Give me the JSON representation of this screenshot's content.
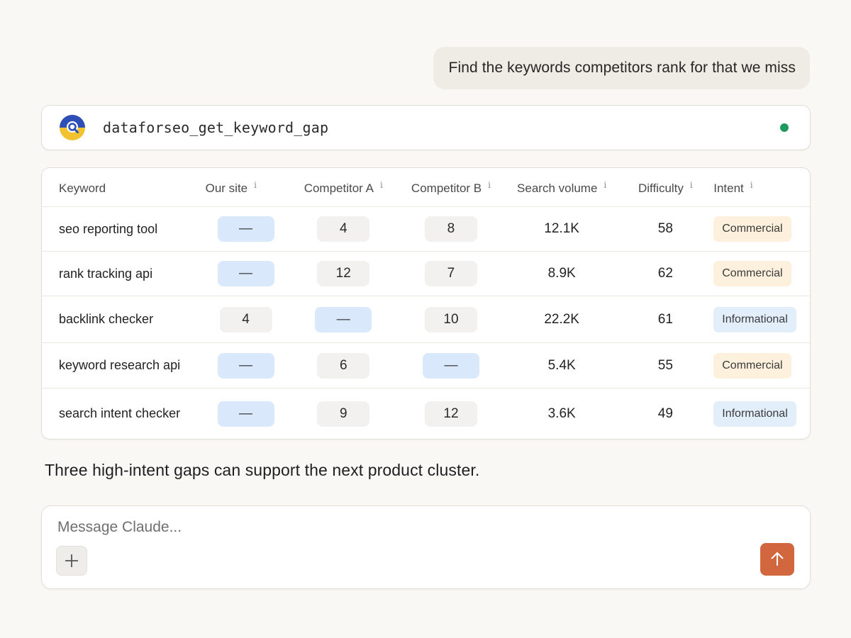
{
  "user_message": "Find the keywords competitors rank for that we miss",
  "tool_call": {
    "name": "dataforseo_get_keyword_gap",
    "icon": "dataforseo-logo-icon",
    "status": "success",
    "status_color": "#1e9a5e"
  },
  "table": {
    "info_marker": "i",
    "headers": {
      "keyword": "Keyword",
      "our_site": "Our site",
      "competitor_a": "Competitor A",
      "competitor_b": "Competitor B",
      "search_volume": "Search volume",
      "difficulty": "Difficulty",
      "intent": "Intent"
    },
    "rows": [
      {
        "keyword": "seo reporting tool",
        "our_site": "—",
        "competitor_a": "4",
        "competitor_b": "8",
        "search_volume": "12.1K",
        "difficulty": "58",
        "intent": "Commercial"
      },
      {
        "keyword": "rank tracking api",
        "our_site": "—",
        "competitor_a": "12",
        "competitor_b": "7",
        "search_volume": "8.9K",
        "difficulty": "62",
        "intent": "Commercial"
      },
      {
        "keyword": "backlink checker",
        "our_site": "4",
        "competitor_a": "—",
        "competitor_b": "10",
        "search_volume": "22.2K",
        "difficulty": "61",
        "intent": "Informational"
      },
      {
        "keyword": "keyword research api",
        "our_site": "—",
        "competitor_a": "6",
        "competitor_b": "—",
        "search_volume": "5.4K",
        "difficulty": "55",
        "intent": "Commercial"
      },
      {
        "keyword": "search intent checker",
        "our_site": "—",
        "competitor_a": "9",
        "competitor_b": "12",
        "search_volume": "3.6K",
        "difficulty": "49",
        "intent": "Informational"
      }
    ]
  },
  "assistant_message": "Three high-intent gaps can support the next product cluster.",
  "composer": {
    "placeholder": "Message Claude...",
    "value": "",
    "add_icon": "plus-icon",
    "send_icon": "arrow-up-icon",
    "send_color": "#d2663f"
  },
  "colors": {
    "background": "#faf8f4",
    "gap_cell": "#d9e9fb",
    "rank_cell": "#f2f1ef",
    "commercial_badge": "#fdf1dd",
    "informational_badge": "#e3eefb"
  }
}
